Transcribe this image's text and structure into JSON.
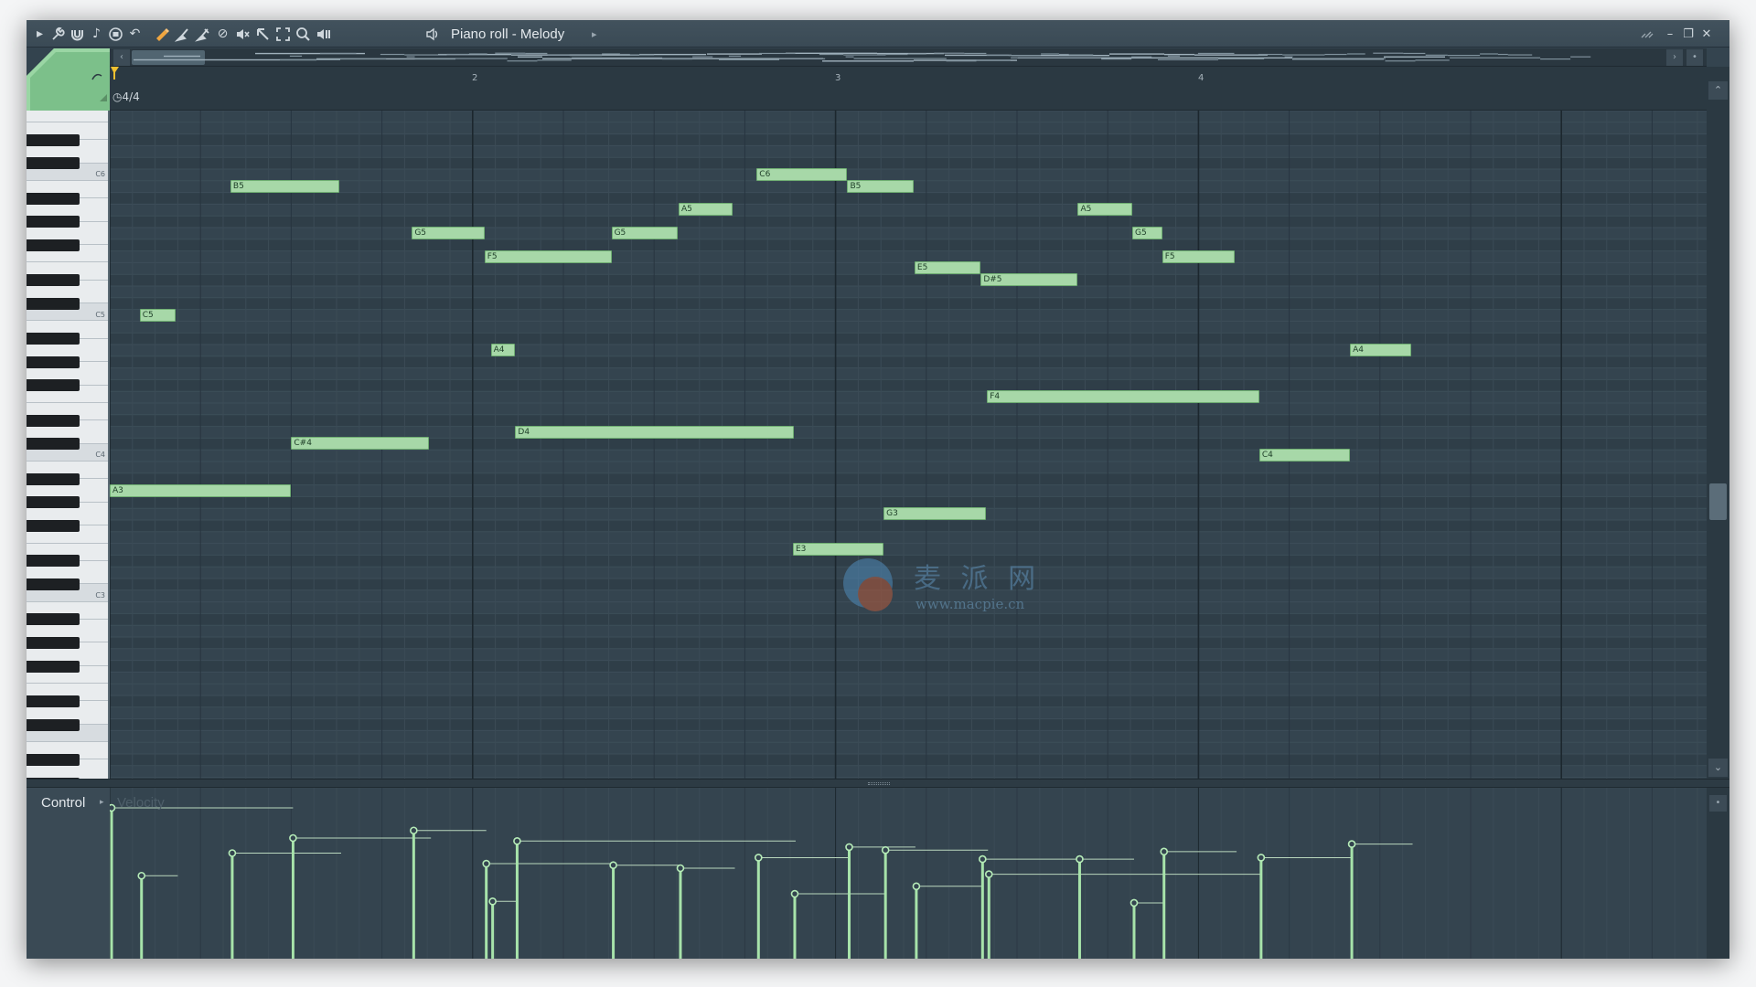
{
  "window": {
    "title": "Piano roll - Melody",
    "title_arrow": "▸",
    "controls": [
      "minimize-icon",
      "restore-icon",
      "close-icon"
    ]
  },
  "toolbar": {
    "icons": [
      "play-arrow-icon",
      "wrench-icon",
      "magnet-icon",
      "note-icon",
      "record-icon",
      "undo-icon",
      "pencil-icon",
      "brush-icon",
      "delete-icon",
      "mute-icon",
      "slip-icon",
      "slice-icon",
      "select-icon",
      "zoom-icon",
      "playback-icon",
      "speaker-icon"
    ]
  },
  "timeline": {
    "bars": [
      "2",
      "3",
      "4"
    ],
    "time_signature": "4/4"
  },
  "keyboard": {
    "labels": [
      "C6",
      "C5",
      "C4",
      "C3"
    ]
  },
  "notes": [
    {
      "label": "A3",
      "start": 0.0,
      "length": 2.0,
      "pitch": 57
    },
    {
      "label": "C5",
      "start": 0.33,
      "length": 0.4,
      "pitch": 72
    },
    {
      "label": "B5",
      "start": 1.33,
      "length": 1.2,
      "pitch": 83
    },
    {
      "label": "C#4",
      "start": 2.0,
      "length": 1.52,
      "pitch": 61
    },
    {
      "label": "G5",
      "start": 3.33,
      "length": 0.8,
      "pitch": 79
    },
    {
      "label": "F5",
      "start": 4.13,
      "length": 1.4,
      "pitch": 77
    },
    {
      "label": "A4",
      "start": 4.2,
      "length": 0.27,
      "pitch": 69
    },
    {
      "label": "D4",
      "start": 4.47,
      "length": 3.07,
      "pitch": 62
    },
    {
      "label": "G5",
      "start": 5.53,
      "length": 0.73,
      "pitch": 79
    },
    {
      "label": "A5",
      "start": 6.27,
      "length": 0.6,
      "pitch": 81
    },
    {
      "label": "C6",
      "start": 7.13,
      "length": 1.0,
      "pitch": 84
    },
    {
      "label": "E3",
      "start": 7.53,
      "length": 1.0,
      "pitch": 52
    },
    {
      "label": "B5",
      "start": 8.13,
      "length": 0.73,
      "pitch": 83
    },
    {
      "label": "G3",
      "start": 8.53,
      "length": 1.13,
      "pitch": 55
    },
    {
      "label": "E5",
      "start": 8.87,
      "length": 0.73,
      "pitch": 76
    },
    {
      "label": "D#5",
      "start": 9.6,
      "length": 1.07,
      "pitch": 75
    },
    {
      "label": "F4",
      "start": 9.67,
      "length": 3.0,
      "pitch": 65
    },
    {
      "label": "A5",
      "start": 10.67,
      "length": 0.6,
      "pitch": 81
    },
    {
      "label": "G5",
      "start": 11.27,
      "length": 0.33,
      "pitch": 79
    },
    {
      "label": "F5",
      "start": 11.6,
      "length": 0.8,
      "pitch": 77
    },
    {
      "label": "C4",
      "start": 12.67,
      "length": 1.0,
      "pitch": 60
    },
    {
      "label": "A4",
      "start": 13.67,
      "length": 0.67,
      "pitch": 69
    }
  ],
  "velocities": [
    1.0,
    0.55,
    0.7,
    0.8,
    0.85,
    0.63,
    0.38,
    0.78,
    0.62,
    0.6,
    0.67,
    0.43,
    0.74,
    0.72,
    0.48,
    0.66,
    0.56,
    0.66,
    0.37,
    0.71,
    0.67,
    0.76
  ],
  "control": {
    "label": "Control",
    "arrow": "▸",
    "parameter": "Velocity"
  },
  "watermark": {
    "text": "麦 派 网",
    "url": "www.macpie.cn"
  },
  "colors": {
    "note_fill": "#a7d8a8",
    "note_border": "#6fae72",
    "background": "#34444f",
    "accent": "#f0a640"
  }
}
